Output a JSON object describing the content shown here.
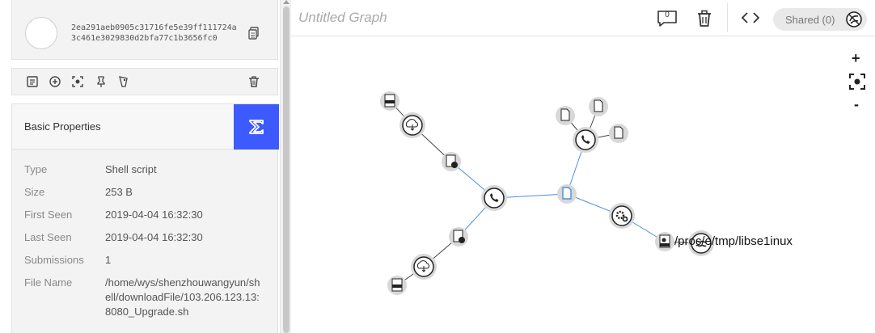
{
  "sample": {
    "hash": "2ea291aeb0905c31716fe5e39ff111724a3c461e3029830d2bfa77c1b3656fc0"
  },
  "toolbar": {
    "icons": [
      "report-icon",
      "add-circle-icon",
      "focus-icon",
      "pin-icon",
      "tag-icon",
      "trash-icon"
    ]
  },
  "properties": {
    "title": "Basic Properties",
    "rows": [
      {
        "key": "Type",
        "value": "Shell script"
      },
      {
        "key": "Size",
        "value": "253 B"
      },
      {
        "key": "First Seen",
        "value": "2019-04-04 16:32:30"
      },
      {
        "key": "Last Seen",
        "value": "2019-04-04 16:32:30"
      },
      {
        "key": "Submissions",
        "value": "1"
      },
      {
        "key": "File Name",
        "value": "/home/wys/shenzhouwangyun/shell/downloadFile/103.206.123.13:8080_Upgrade.sh"
      }
    ]
  },
  "graph": {
    "title": "Untitled Graph",
    "comment_count": "0",
    "shared_label": "Shared (0)",
    "zoom_in": "+",
    "zoom_out": "-",
    "node_label": "/proc/e/tmp/libse1inux"
  },
  "colors": {
    "accent": "#3d5afe",
    "edge_blue": "#4a8fe0",
    "edge_dark": "#333333"
  }
}
